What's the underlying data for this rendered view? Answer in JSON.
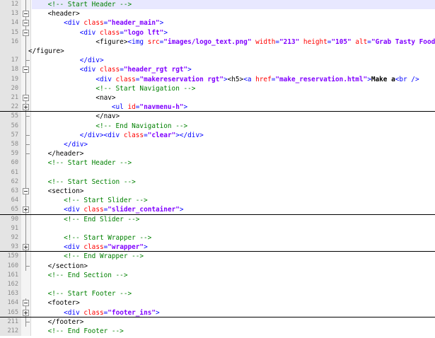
{
  "editor": {
    "lines": [
      {
        "num": "12",
        "indent": 4,
        "fold": "line",
        "current": true,
        "tokens": [
          {
            "c": "cm",
            "s": "<!-- Start Header -->"
          }
        ]
      },
      {
        "num": "13",
        "indent": 4,
        "fold": "minus",
        "tokens": [
          {
            "c": "t",
            "s": "<header>"
          }
        ]
      },
      {
        "num": "14",
        "indent": 8,
        "fold": "minus",
        "tokens": [
          {
            "c": "tag",
            "s": "<div "
          },
          {
            "c": "attr",
            "s": "class"
          },
          {
            "c": "tag",
            "s": "="
          },
          {
            "c": "val",
            "s": "\"header_main\""
          },
          {
            "c": "tag",
            "s": ">"
          }
        ]
      },
      {
        "num": "15",
        "indent": 12,
        "fold": "minus",
        "tokens": [
          {
            "c": "tag",
            "s": "<div "
          },
          {
            "c": "attr",
            "s": "class"
          },
          {
            "c": "tag",
            "s": "="
          },
          {
            "c": "val",
            "s": "\"logo lft\""
          },
          {
            "c": "tag",
            "s": ">"
          }
        ]
      },
      {
        "num": "16",
        "indent": 16,
        "fold": "line",
        "tokens": [
          {
            "c": "t",
            "s": "<figure>"
          },
          {
            "c": "tag",
            "s": "<img "
          },
          {
            "c": "attr",
            "s": "src"
          },
          {
            "c": "tag",
            "s": "="
          },
          {
            "c": "val",
            "s": "\"images/logo_text.png\""
          },
          {
            "c": "tag",
            "s": " "
          },
          {
            "c": "attr",
            "s": "width"
          },
          {
            "c": "tag",
            "s": "="
          },
          {
            "c": "val",
            "s": "\"213\""
          },
          {
            "c": "tag",
            "s": " "
          },
          {
            "c": "attr",
            "s": "height"
          },
          {
            "c": "tag",
            "s": "="
          },
          {
            "c": "val",
            "s": "\"105\""
          },
          {
            "c": "tag",
            "s": " "
          },
          {
            "c": "attr",
            "s": "alt"
          },
          {
            "c": "tag",
            "s": "="
          },
          {
            "c": "val",
            "s": "\"Grab Tasty Food\""
          }
        ]
      },
      {
        "num": "",
        "indent": 0,
        "fold": "line",
        "wrap": true,
        "tokens": [
          {
            "c": "t",
            "s": "</figure>"
          }
        ]
      },
      {
        "num": "17",
        "indent": 12,
        "fold": "tick",
        "tokens": [
          {
            "c": "tag",
            "s": "</div>"
          }
        ]
      },
      {
        "num": "18",
        "indent": 12,
        "fold": "minus",
        "tokens": [
          {
            "c": "tag",
            "s": "<div "
          },
          {
            "c": "attr",
            "s": "class"
          },
          {
            "c": "tag",
            "s": "="
          },
          {
            "c": "val",
            "s": "\"header_rgt rgt\""
          },
          {
            "c": "tag",
            "s": ">"
          }
        ]
      },
      {
        "num": "19",
        "indent": 16,
        "fold": "line",
        "tokens": [
          {
            "c": "tag",
            "s": "<div "
          },
          {
            "c": "attr",
            "s": "class"
          },
          {
            "c": "tag",
            "s": "="
          },
          {
            "c": "val",
            "s": "\"makereservation rgt\""
          },
          {
            "c": "tag",
            "s": ">"
          },
          {
            "c": "t",
            "s": "<h5>"
          },
          {
            "c": "tag",
            "s": "<a "
          },
          {
            "c": "attr",
            "s": "href"
          },
          {
            "c": "tag",
            "s": "="
          },
          {
            "c": "val",
            "s": "\"make_reservation.html\""
          },
          {
            "c": "tag",
            "s": ">"
          },
          {
            "c": "txt",
            "s": "Make a"
          },
          {
            "c": "tag",
            "s": "<br />"
          }
        ]
      },
      {
        "num": "20",
        "indent": 16,
        "fold": "line",
        "tokens": [
          {
            "c": "cm",
            "s": "<!-- Start Navigation -->"
          }
        ]
      },
      {
        "num": "21",
        "indent": 16,
        "fold": "minus",
        "tokens": [
          {
            "c": "t",
            "s": "<nav>"
          }
        ]
      },
      {
        "num": "22",
        "indent": 20,
        "fold": "plus",
        "folded": true,
        "tokens": [
          {
            "c": "tag",
            "s": "<ul "
          },
          {
            "c": "attr",
            "s": "id"
          },
          {
            "c": "tag",
            "s": "="
          },
          {
            "c": "val",
            "s": "\"navmenu-h\""
          },
          {
            "c": "tag",
            "s": ">"
          }
        ]
      },
      {
        "num": "55",
        "indent": 16,
        "fold": "tick",
        "tokens": [
          {
            "c": "t",
            "s": "</nav>"
          }
        ]
      },
      {
        "num": "56",
        "indent": 16,
        "fold": "line",
        "tokens": [
          {
            "c": "cm",
            "s": "<!-- End Navigation -->"
          }
        ]
      },
      {
        "num": "57",
        "indent": 12,
        "fold": "tick",
        "tokens": [
          {
            "c": "tag",
            "s": "</div><div "
          },
          {
            "c": "attr",
            "s": "class"
          },
          {
            "c": "tag",
            "s": "="
          },
          {
            "c": "val",
            "s": "\"clear\""
          },
          {
            "c": "tag",
            "s": "></div>"
          }
        ]
      },
      {
        "num": "58",
        "indent": 8,
        "fold": "tick",
        "tokens": [
          {
            "c": "tag",
            "s": "</div>"
          }
        ]
      },
      {
        "num": "59",
        "indent": 4,
        "fold": "tick",
        "tokens": [
          {
            "c": "t",
            "s": "</header>"
          }
        ]
      },
      {
        "num": "60",
        "indent": 4,
        "fold": "line",
        "tokens": [
          {
            "c": "cm",
            "s": "<!-- Start Header -->"
          }
        ]
      },
      {
        "num": "61",
        "indent": 0,
        "fold": "line",
        "tokens": []
      },
      {
        "num": "62",
        "indent": 4,
        "fold": "line",
        "tokens": [
          {
            "c": "cm",
            "s": "<!-- Start Section -->"
          }
        ]
      },
      {
        "num": "63",
        "indent": 4,
        "fold": "minus",
        "tokens": [
          {
            "c": "t",
            "s": "<section>"
          }
        ]
      },
      {
        "num": "64",
        "indent": 8,
        "fold": "line",
        "tokens": [
          {
            "c": "cm",
            "s": "<!-- Start Slider -->"
          }
        ]
      },
      {
        "num": "65",
        "indent": 8,
        "fold": "plus",
        "folded": true,
        "tokens": [
          {
            "c": "tag",
            "s": "<div "
          },
          {
            "c": "attr",
            "s": "class"
          },
          {
            "c": "tag",
            "s": "="
          },
          {
            "c": "val",
            "s": "\"slider_container\""
          },
          {
            "c": "tag",
            "s": ">"
          }
        ]
      },
      {
        "num": "90",
        "indent": 8,
        "fold": "line",
        "tokens": [
          {
            "c": "cm",
            "s": "<!-- End Slider -->"
          }
        ]
      },
      {
        "num": "91",
        "indent": 0,
        "fold": "line",
        "tokens": []
      },
      {
        "num": "92",
        "indent": 8,
        "fold": "line",
        "tokens": [
          {
            "c": "cm",
            "s": "<!-- Start Wrapper -->"
          }
        ]
      },
      {
        "num": "93",
        "indent": 8,
        "fold": "plus",
        "folded": true,
        "tokens": [
          {
            "c": "tag",
            "s": "<div "
          },
          {
            "c": "attr",
            "s": "class"
          },
          {
            "c": "tag",
            "s": "="
          },
          {
            "c": "val",
            "s": "\"wrapper\""
          },
          {
            "c": "tag",
            "s": ">"
          }
        ]
      },
      {
        "num": "159",
        "indent": 8,
        "fold": "line",
        "tokens": [
          {
            "c": "cm",
            "s": "<!-- End Wrapper -->"
          }
        ]
      },
      {
        "num": "160",
        "indent": 4,
        "fold": "tick",
        "tokens": [
          {
            "c": "t",
            "s": "</section>"
          }
        ]
      },
      {
        "num": "161",
        "indent": 4,
        "fold": "none",
        "tokens": [
          {
            "c": "cm",
            "s": "<!-- End Section -->"
          }
        ]
      },
      {
        "num": "162",
        "indent": 0,
        "fold": "none",
        "tokens": []
      },
      {
        "num": "163",
        "indent": 4,
        "fold": "none",
        "tokens": [
          {
            "c": "cm",
            "s": "<!-- Start Footer -->"
          }
        ]
      },
      {
        "num": "164",
        "indent": 4,
        "fold": "minus",
        "tokens": [
          {
            "c": "t",
            "s": "<footer>"
          }
        ]
      },
      {
        "num": "165",
        "indent": 8,
        "fold": "plus",
        "folded": true,
        "tokens": [
          {
            "c": "tag",
            "s": "<div "
          },
          {
            "c": "attr",
            "s": "class"
          },
          {
            "c": "tag",
            "s": "="
          },
          {
            "c": "val",
            "s": "\"footer_ins\""
          },
          {
            "c": "tag",
            "s": ">"
          }
        ]
      },
      {
        "num": "211",
        "indent": 4,
        "fold": "tick",
        "tokens": [
          {
            "c": "t",
            "s": "</footer>"
          }
        ]
      },
      {
        "num": "212",
        "indent": 4,
        "fold": "none",
        "tokens": [
          {
            "c": "cm",
            "s": "<!-- End Footer -->"
          }
        ]
      }
    ]
  }
}
